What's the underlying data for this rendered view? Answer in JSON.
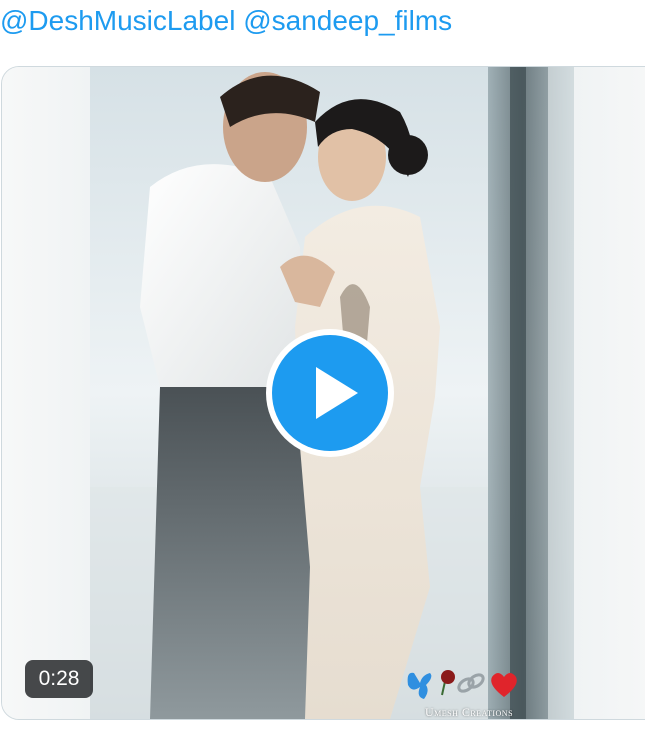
{
  "tweet": {
    "mentions": [
      "@DeshMusicLabel",
      "@sandeep_films"
    ]
  },
  "media": {
    "type": "video",
    "duration": "0:28",
    "play_icon": "play-icon",
    "watermark": {
      "emoji": "🦋🥀🔗❤️",
      "text": "Umesh Creations"
    }
  },
  "colors": {
    "link": "#1d9bf0",
    "play_button": "#1d9bf0",
    "card_border": "#cfd9de",
    "badge_bg": "#14171a"
  }
}
